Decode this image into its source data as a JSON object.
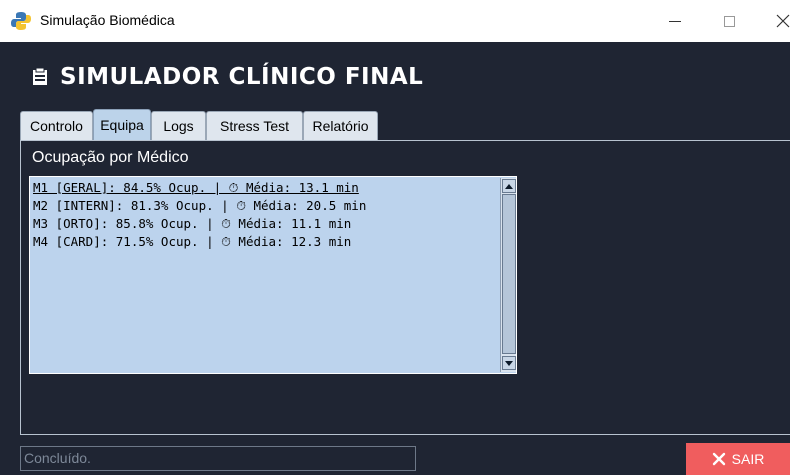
{
  "window": {
    "title": "Simulação Biomédica",
    "controls": {
      "minimize": "minimize-icon",
      "maximize": "maximize-icon",
      "close": "close-icon"
    }
  },
  "heading": {
    "icon": "clipboard-icon",
    "title": "SIMULADOR CLÍNICO FINAL"
  },
  "tabs": [
    {
      "label": "Controlo",
      "active": false
    },
    {
      "label": "Equipa",
      "active": true
    },
    {
      "label": "Logs",
      "active": false
    },
    {
      "label": "Stress Test",
      "active": false
    },
    {
      "label": "Relatório",
      "active": false
    }
  ],
  "panel": {
    "label": "Ocupação por Médico",
    "rows": [
      {
        "text": "M1 [GERAL]: 84.5% Ocup. | ⏱ Média: 13.1 min",
        "selected": true
      },
      {
        "text": "M2 [INTERN]: 81.3% Ocup. | ⏱ Média: 20.5 min",
        "selected": false
      },
      {
        "text": "M3 [ORTO]: 85.8% Ocup. | ⏱ Média: 11.1 min",
        "selected": false
      },
      {
        "text": "M4 [CARD]: 71.5% Ocup. | ⏱ Média: 12.3 min",
        "selected": false
      }
    ]
  },
  "status": {
    "value": "Concluído."
  },
  "exit_button": {
    "label": "SAIR",
    "icon": "close-icon"
  },
  "colors": {
    "background": "#1f2533",
    "tab_active": "#bcd3ea",
    "listbox": "#bcd3ed",
    "exit": "#f05d5e"
  }
}
